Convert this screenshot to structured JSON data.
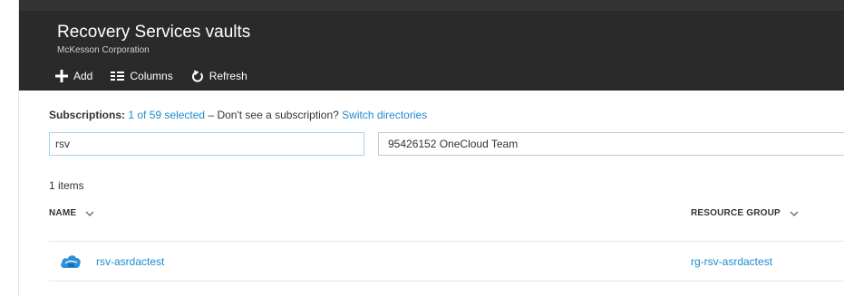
{
  "blade": {
    "title": "Recovery Services vaults",
    "subtitle": "McKesson Corporation"
  },
  "toolbar": {
    "add_label": "Add",
    "columns_label": "Columns",
    "refresh_label": "Refresh"
  },
  "subscriptions": {
    "label": "Subscriptions:",
    "selected_link": "1 of 59 selected",
    "separator_text": "– Don't see a subscription?",
    "switch_link": "Switch directories"
  },
  "filter": {
    "value": "rsv"
  },
  "subscription_select": {
    "value": "95426152 OneCloud Team"
  },
  "results": {
    "count_text": "1 items"
  },
  "table": {
    "columns": [
      {
        "label": "NAME"
      },
      {
        "label": "RESOURCE GROUP"
      }
    ],
    "rows": [
      {
        "name": "rsv-asrdactest",
        "resource_group": "rg-rsv-asrdactest"
      }
    ]
  },
  "colors": {
    "header_bg": "#2a2a2a",
    "link": "#1e8ad0",
    "input_focus_border": "#9fd3f0"
  },
  "icons": {
    "add": "plus-icon",
    "columns": "columns-icon",
    "refresh": "refresh-icon",
    "sort": "chevron-down-icon",
    "vault": "cloud-vault-icon"
  }
}
